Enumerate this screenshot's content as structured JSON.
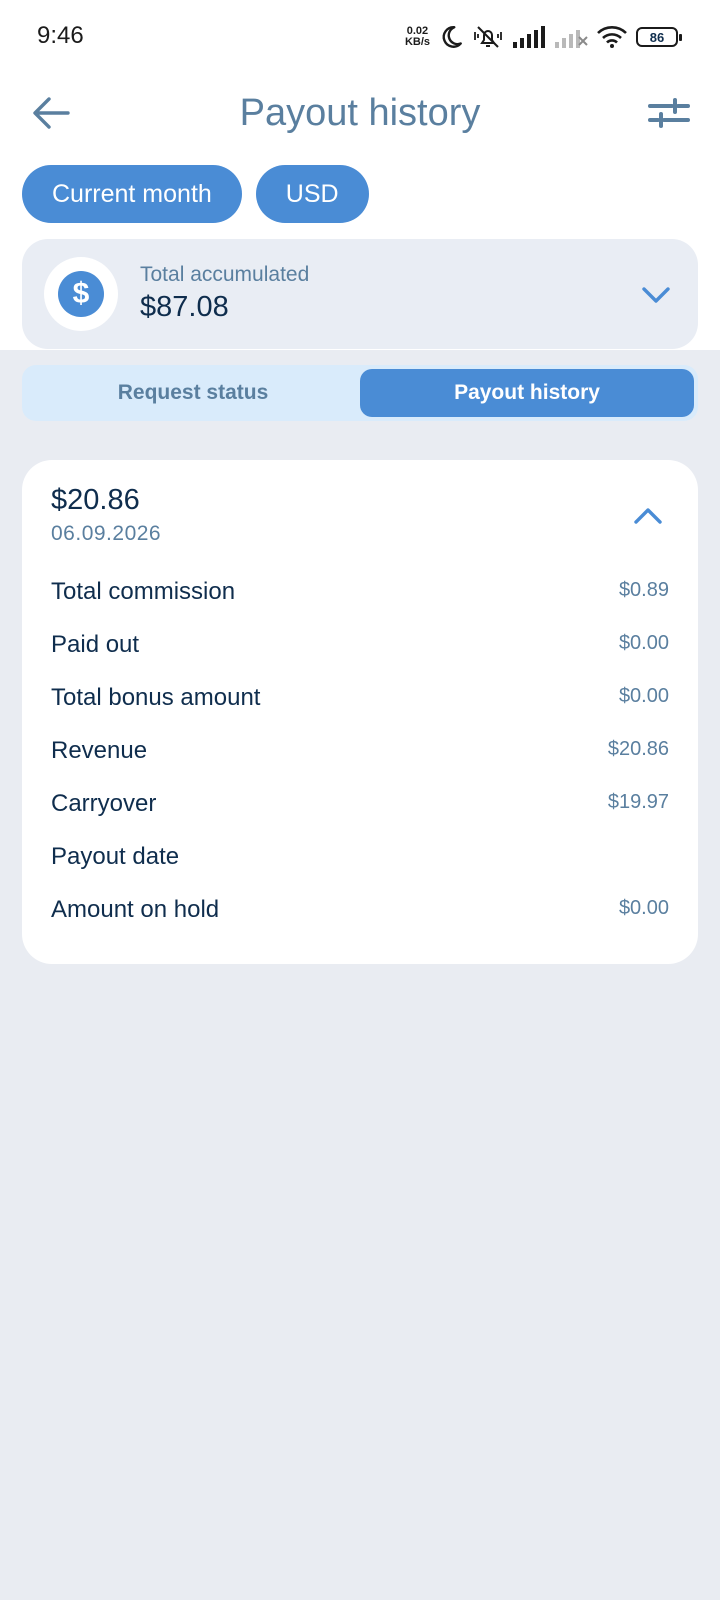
{
  "status_bar": {
    "time": "9:46",
    "net_speed_value": "0.02",
    "net_speed_unit": "KB/s",
    "battery": "86"
  },
  "header": {
    "title": "Payout history",
    "back_icon": "arrow-left-icon",
    "filter_icon": "sliders-icon"
  },
  "chips": [
    {
      "label": "Current month"
    },
    {
      "label": "USD"
    }
  ],
  "summary": {
    "label": "Total accumulated",
    "value": "$87.08",
    "icon": "dollar-icon",
    "icon_glyph": "$"
  },
  "tabs": [
    {
      "label": "Request status",
      "active": false
    },
    {
      "label": "Payout history",
      "active": true
    }
  ],
  "payout": {
    "amount": "$20.86",
    "date": "06.09.2026",
    "rows": [
      {
        "label": "Total commission",
        "value": "$0.89"
      },
      {
        "label": "Paid out",
        "value": "$0.00"
      },
      {
        "label": "Total bonus amount",
        "value": "$0.00"
      },
      {
        "label": "Revenue",
        "value": "$20.86"
      },
      {
        "label": "Carryover",
        "value": "$19.97"
      },
      {
        "label": "Payout date",
        "value": ""
      },
      {
        "label": "Amount on hold",
        "value": "$0.00"
      }
    ]
  },
  "colors": {
    "accent": "#4a8cd5",
    "title": "#5a7f9f",
    "text": "#0f2d4d",
    "background": "#e9ecf2"
  }
}
